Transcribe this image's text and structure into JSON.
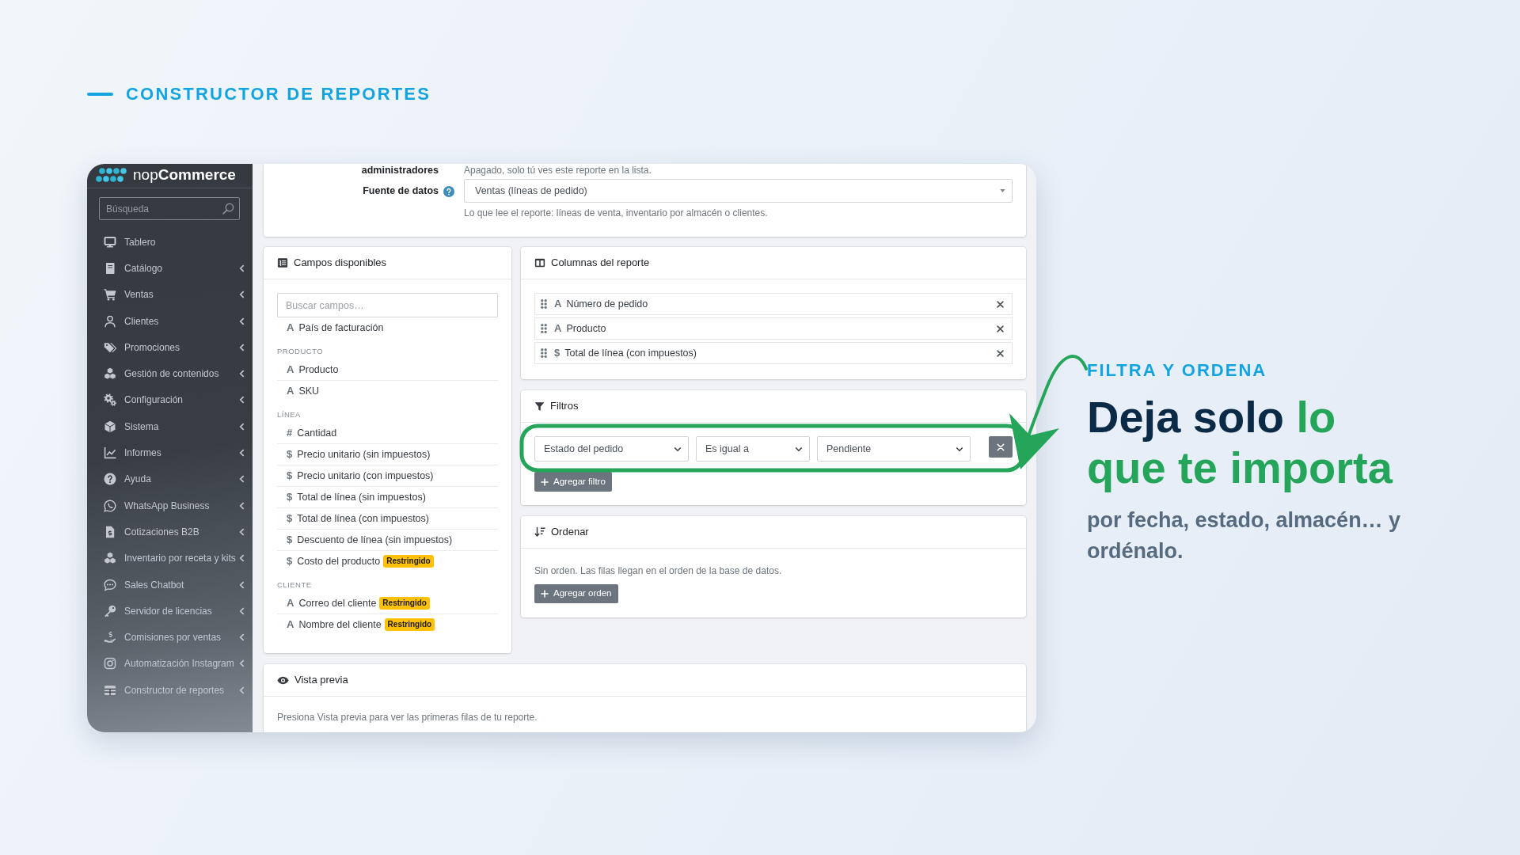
{
  "page_heading": "CONSTRUCTOR DE REPORTES",
  "app": {
    "logo": "nop**Commerce**",
    "search": {
      "placeholder": "Búsqueda"
    },
    "sidebar": {
      "items": [
        {
          "label": "Tablero",
          "expandable": false
        },
        {
          "label": "Catálogo",
          "expandable": true
        },
        {
          "label": "Ventas",
          "expandable": true
        },
        {
          "label": "Clientes",
          "expandable": true
        },
        {
          "label": "Promociones",
          "expandable": true
        },
        {
          "label": "Gestión de contenidos",
          "expandable": true
        },
        {
          "label": "Configuración",
          "expandable": true
        },
        {
          "label": "Sistema",
          "expandable": true
        },
        {
          "label": "Informes",
          "expandable": true
        },
        {
          "label": "Ayuda",
          "expandable": true
        },
        {
          "label": "WhatsApp Business",
          "expandable": true
        },
        {
          "label": "Cotizaciones B2B",
          "expandable": true
        },
        {
          "label": "Inventario por receta y kits",
          "expandable": true
        },
        {
          "label": "Sales Chatbot",
          "expandable": true
        },
        {
          "label": "Servidor de licencias",
          "expandable": true
        },
        {
          "label": "Comisiones por ventas",
          "expandable": true
        },
        {
          "label": "Automatización Instagram",
          "expandable": true
        },
        {
          "label": "Constructor de reportes",
          "expandable": true
        }
      ]
    },
    "settings": {
      "visibility": {
        "label": "administradores",
        "hint": "Apagado, solo tú ves este reporte en la lista."
      },
      "data_source": {
        "label": "Fuente de datos",
        "value": "Ventas (líneas de pedido)",
        "hint": "Lo que lee el reporte: líneas de venta, inventario por almacén o clientes."
      }
    },
    "available_fields": {
      "title": "Campos disponibles",
      "search": {
        "placeholder": "Buscar campos…"
      },
      "groups": [
        {
          "fields": [
            {
              "symbol": "A",
              "name": "País de facturación"
            }
          ]
        },
        {
          "label": "PRODUCTO",
          "fields": [
            {
              "symbol": "A",
              "name": "Producto"
            },
            {
              "symbol": "A",
              "name": "SKU"
            }
          ]
        },
        {
          "label": "LÍNEA",
          "fields": [
            {
              "symbol": "#",
              "name": "Cantidad"
            },
            {
              "symbol": "$",
              "name": "Precio unitario (sin impuestos)"
            },
            {
              "symbol": "$",
              "name": "Precio unitario (con impuestos)"
            },
            {
              "symbol": "$",
              "name": "Total de línea (sin impuestos)"
            },
            {
              "symbol": "$",
              "name": "Total de línea (con impuestos)"
            },
            {
              "symbol": "$",
              "name": "Descuento de línea (sin impuestos)"
            },
            {
              "symbol": "$",
              "name": "Costo del producto",
              "badge": "Restringido"
            }
          ]
        },
        {
          "label": "CLIENTE",
          "fields": [
            {
              "symbol": "A",
              "name": "Correo del cliente",
              "badge": "Restringido"
            },
            {
              "symbol": "A",
              "name": "Nombre del cliente",
              "badge": "Restringido"
            }
          ]
        }
      ]
    },
    "report_columns": {
      "title": "Columnas del reporte",
      "columns": [
        {
          "symbol": "A",
          "label": "Número de pedido"
        },
        {
          "symbol": "A",
          "label": "Producto"
        },
        {
          "symbol": "$",
          "label": "Total de línea (con impuestos)"
        }
      ]
    },
    "filters": {
      "title": "Filtros",
      "rows": [
        {
          "field": "Estado del pedido",
          "operator": "Es igual a",
          "value": "Pendiente"
        }
      ],
      "add_button": "Agregar filtro"
    },
    "sort": {
      "title": "Ordenar",
      "empty_text": "Sin orden. Las filas llegan en el orden de la base de datos.",
      "add_button": "Agregar orden"
    },
    "preview": {
      "title": "Vista previa",
      "hint": "Presiona Vista previa para ver las primeras filas de tu reporte."
    }
  },
  "callout": {
    "eyebrow": "FILTRA Y ORDENA",
    "headline": [
      {
        "text": "Deja solo",
        "accent": false
      },
      {
        "text": "lo que te importa",
        "accent": true
      }
    ],
    "subtitle": "por fecha, estado, almacén… y ordénalo."
  }
}
